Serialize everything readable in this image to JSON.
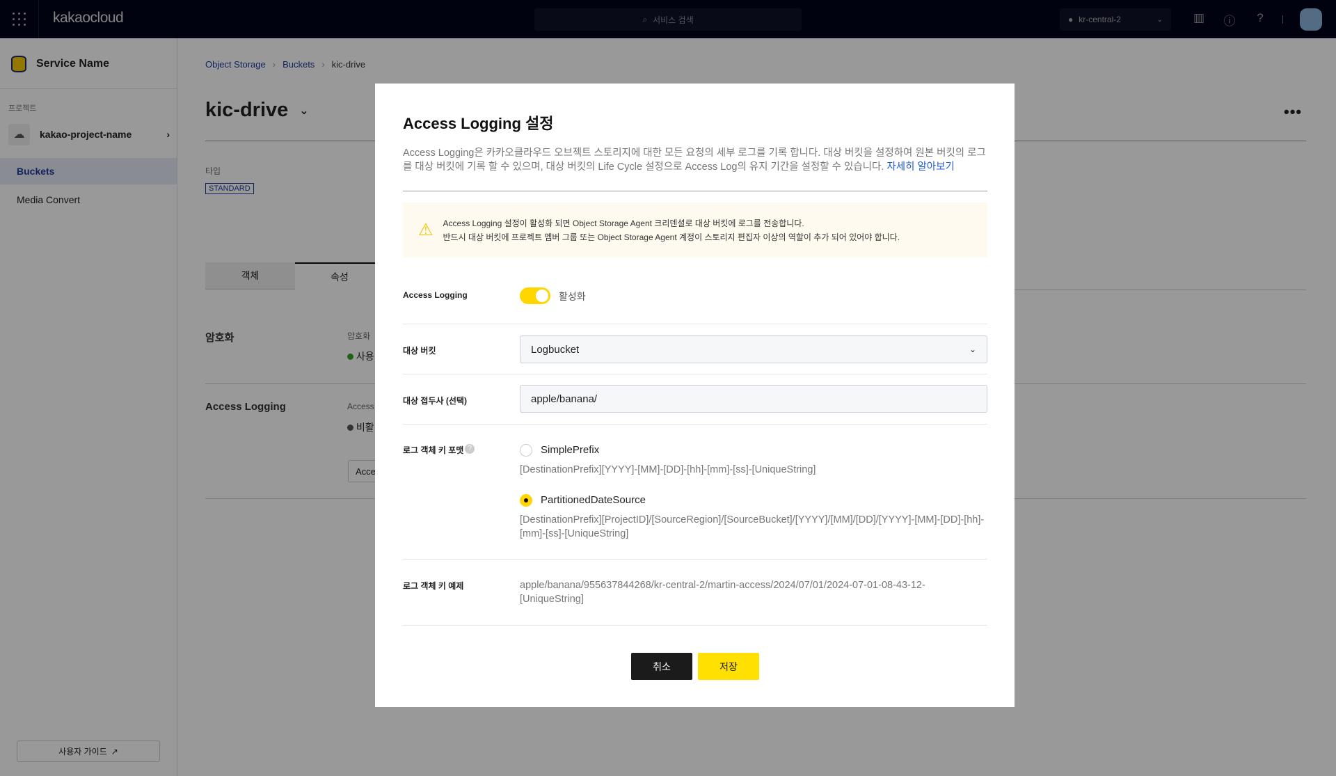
{
  "header": {
    "logo": "kakaocloud",
    "search_placeholder": "서비스 검색",
    "region": "kr-central-2"
  },
  "sidebar": {
    "service_name": "Service Name",
    "project_label": "프로젝트",
    "project_name": "kakao-project-name",
    "items": [
      {
        "label": "Buckets",
        "active": true
      },
      {
        "label": "Media Convert",
        "active": false
      }
    ],
    "guide": "사용자 가이드"
  },
  "main": {
    "breadcrumb": [
      "Object Storage",
      "Buckets",
      "kic-drive"
    ],
    "title": "kic-drive",
    "type_label": "타입",
    "type_value": "STANDARD",
    "tabs": [
      {
        "label": "객체"
      },
      {
        "label": "속성",
        "active": true
      }
    ],
    "encryption": {
      "title": "암호화",
      "label": "암호화",
      "status": "사용"
    },
    "access_logging": {
      "title": "Access Logging",
      "label": "Access",
      "status": "비활",
      "button": "Acce"
    }
  },
  "modal": {
    "title": "Access Logging 설정",
    "description": "Access Logging은 카카오클라우드 오브젝트 스토리지에 대한 모든 요청의 세부 로그를 기록 합니다. 대상 버킷을 설정하여 원본 버킷의 로그를 대상 버킷에 기록 할 수 있으며, 대상 버킷의 Life Cycle 설정으로 Access Log의 유지 기간을 설정할 수 있습니다.",
    "learn_more": "자세히 알아보기",
    "warning": [
      "Access Logging 설정이 활성화 되면 Object Storage Agent 크리덴셜로 대상 버킷에 로그를 전송합니다.",
      "반드시 대상 버킷에 프로젝트 멤버 그룹 또는 Object Storage Agent 계정이 스토리지 편집자 이상의 역할이 추가 되어 있어야 합니다."
    ],
    "fields": {
      "access_logging": {
        "label": "Access Logging",
        "toggle_label": "활성화",
        "enabled": true
      },
      "target_bucket": {
        "label": "대상 버킷",
        "value": "Logbucket"
      },
      "target_prefix": {
        "label": "대상 접두사 (선택)",
        "value": "apple/banana/"
      },
      "key_format": {
        "label": "로그 객체 키 포맷",
        "options": [
          {
            "label": "SimplePrefix",
            "desc": "[DestinationPrefix][YYYY]-[MM]-[DD]-[hh]-[mm]-[ss]-[UniqueString]",
            "selected": false
          },
          {
            "label": "PartitionedDateSource",
            "desc": "[DestinationPrefix][ProjectID]/[SourceRegion]/[SourceBucket]/[YYYY]/[MM]/[DD]/[YYYY]-[MM]-[DD]-[hh]-[mm]-[ss]-[UniqueString]",
            "selected": true
          }
        ]
      },
      "key_example": {
        "label": "로그 객체 키 예제",
        "value": "apple/banana/955637844268/kr-central-2/martin-access/2024/07/01/2024-07-01-08-43-12-[UniqueString]"
      }
    },
    "cancel": "취소",
    "save": "저장"
  },
  "colors": {
    "accent": "#ffd600",
    "brand_blue": "#1f3a9e",
    "header_bg": "#000419"
  }
}
